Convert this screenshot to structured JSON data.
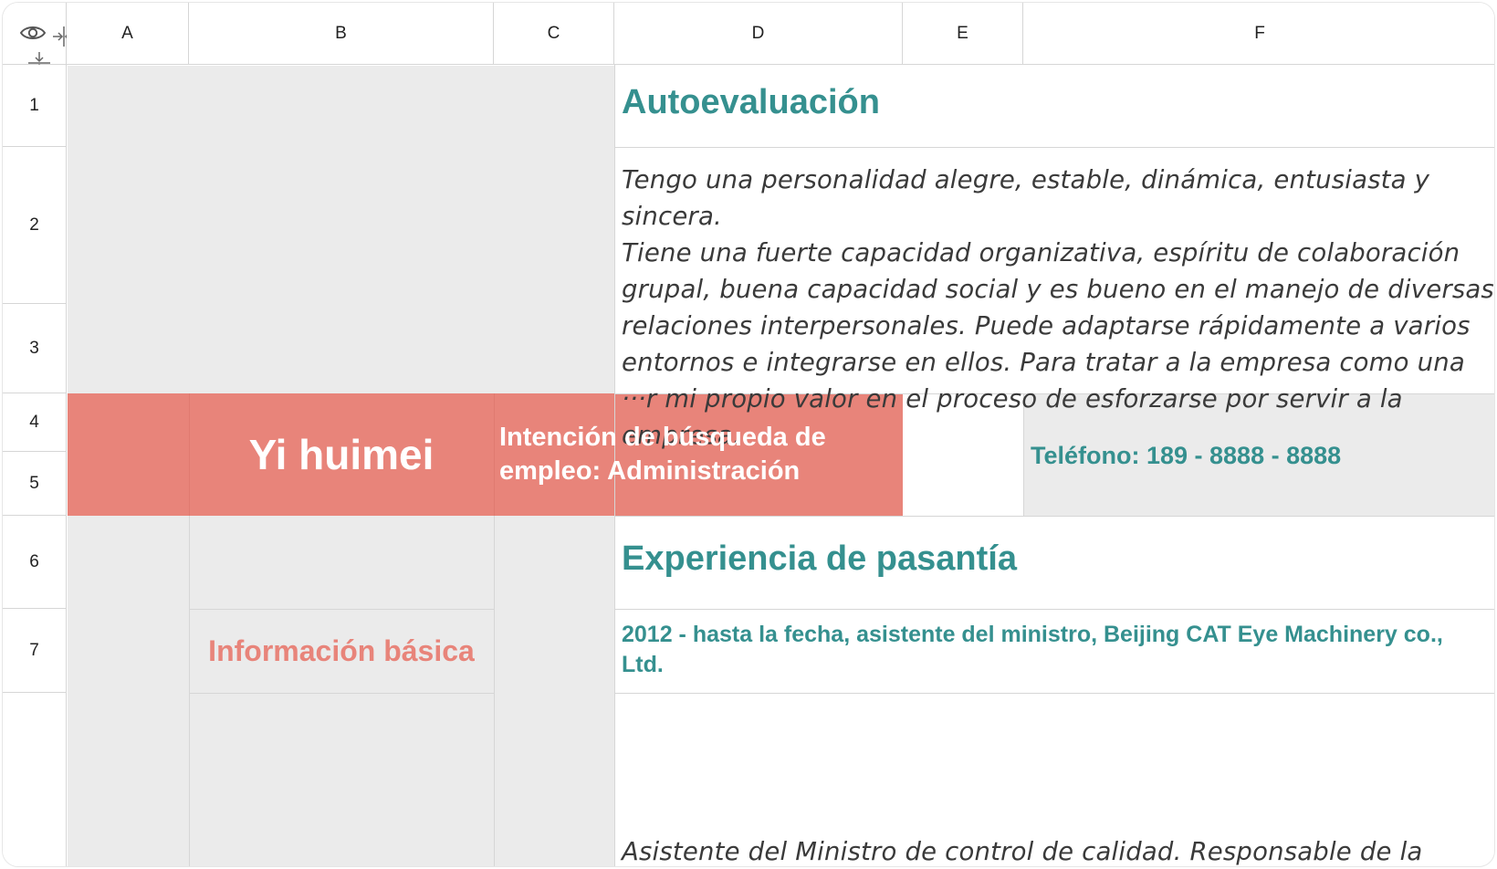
{
  "columns": [
    "A",
    "B",
    "C",
    "D",
    "E",
    "F"
  ],
  "rows": [
    "1",
    "2",
    "3",
    "4",
    "5",
    "6",
    "7"
  ],
  "cells": {
    "self_eval_title": "Autoevaluación",
    "self_eval_lines": [
      "Tengo una personalidad alegre, estable, dinámica, entusiasta y sincera.",
      "Tiene una fuerte capacidad organizativa, espíritu de colaboración",
      "grupal, buena capacidad social y es bueno en el manejo de diversas",
      "relaciones interpersonales. Puede adaptarse rápidamente a varios",
      "entornos e integrarse en ellos. Para tratar a la empresa como una",
      "···r mi propio valor en el proceso de esforzarse por servir a la empresa."
    ],
    "name": "Yi huimei",
    "job_intent": "Intención de búsqueda de empleo: Administración",
    "phone": "Teléfono: 189 - 8888 - 8888",
    "internship_title": "Experiencia de pasantía",
    "basic_info": "Información básica",
    "internship_entry": "2012 - hasta la fecha, asistente del ministro, Beijing CAT Eye Machinery co., Ltd.",
    "internship_desc": "Asistente del Ministro de control de calidad. Responsable de la"
  },
  "icons": {
    "toggle_visibility": "eye-icon",
    "collapse_columns": "collapse-columns-icon",
    "collapse_rows": "collapse-rows-icon"
  },
  "colors": {
    "accent_teal": "#35908f",
    "salmon": "#e8847a",
    "salmon_text": "#e8847a",
    "gray_fill": "#ebebeb"
  }
}
